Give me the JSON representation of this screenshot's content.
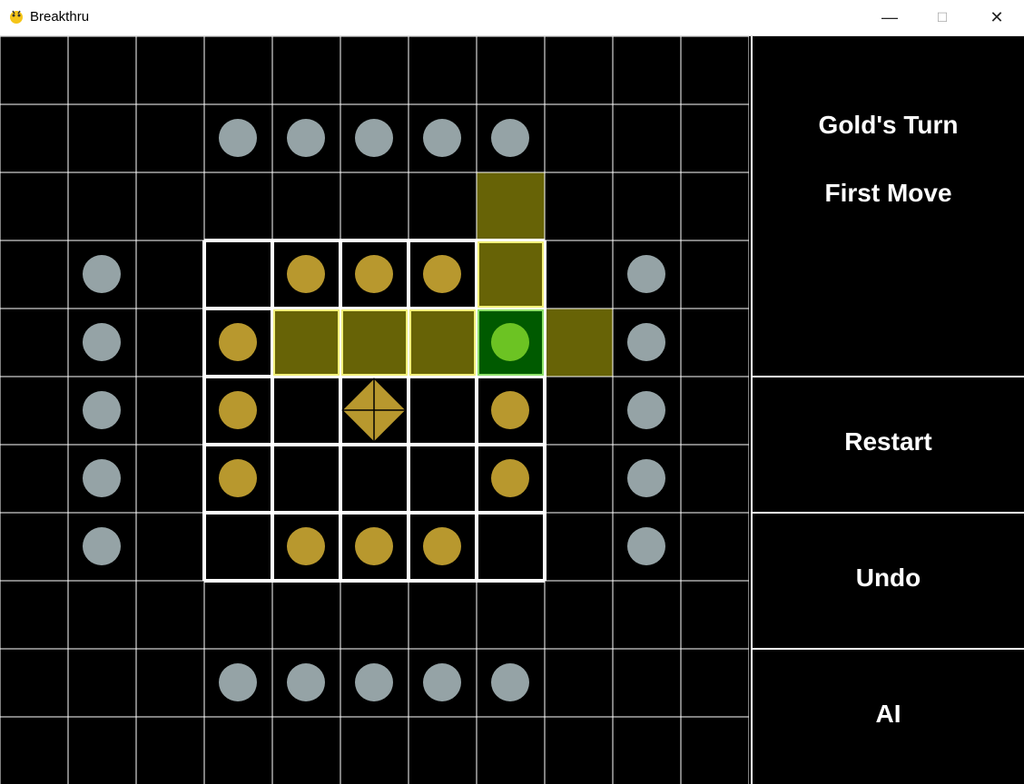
{
  "window": {
    "title": "Breakthru",
    "minimize": "—",
    "maximize": "☐",
    "close": "✕"
  },
  "colors": {
    "silver": "#95a3a6",
    "gold": "#b8982e",
    "highlight": "#676306",
    "selected": "#005a00",
    "selected_piece": "#6cc323",
    "grid": "#ffffff"
  },
  "board": {
    "size": 11,
    "silver_pieces": [
      [
        1,
        3
      ],
      [
        1,
        4
      ],
      [
        1,
        5
      ],
      [
        1,
        6
      ],
      [
        1,
        7
      ],
      [
        3,
        1
      ],
      [
        4,
        1
      ],
      [
        5,
        1
      ],
      [
        6,
        1
      ],
      [
        7,
        1
      ],
      [
        3,
        9
      ],
      [
        4,
        9
      ],
      [
        5,
        9
      ],
      [
        6,
        9
      ],
      [
        7,
        9
      ],
      [
        9,
        3
      ],
      [
        9,
        4
      ],
      [
        9,
        5
      ],
      [
        9,
        6
      ],
      [
        9,
        7
      ]
    ],
    "gold_pieces": [
      [
        3,
        4
      ],
      [
        3,
        5
      ],
      [
        3,
        6
      ],
      [
        4,
        3
      ],
      [
        5,
        3
      ],
      [
        6,
        3
      ],
      [
        5,
        7
      ],
      [
        6,
        7
      ],
      [
        7,
        4
      ],
      [
        7,
        5
      ],
      [
        7,
        6
      ]
    ],
    "flagship": [
      5,
      5
    ],
    "selected_piece": [
      4,
      7
    ],
    "move_targets": [
      [
        2,
        7
      ],
      [
        3,
        7
      ],
      [
        4,
        4
      ],
      [
        4,
        5
      ],
      [
        4,
        6
      ],
      [
        4,
        8
      ]
    ]
  },
  "panel": {
    "turn": "Gold's Turn",
    "phase": "First Move",
    "restart": "Restart",
    "undo": "Undo",
    "ai": "AI"
  }
}
